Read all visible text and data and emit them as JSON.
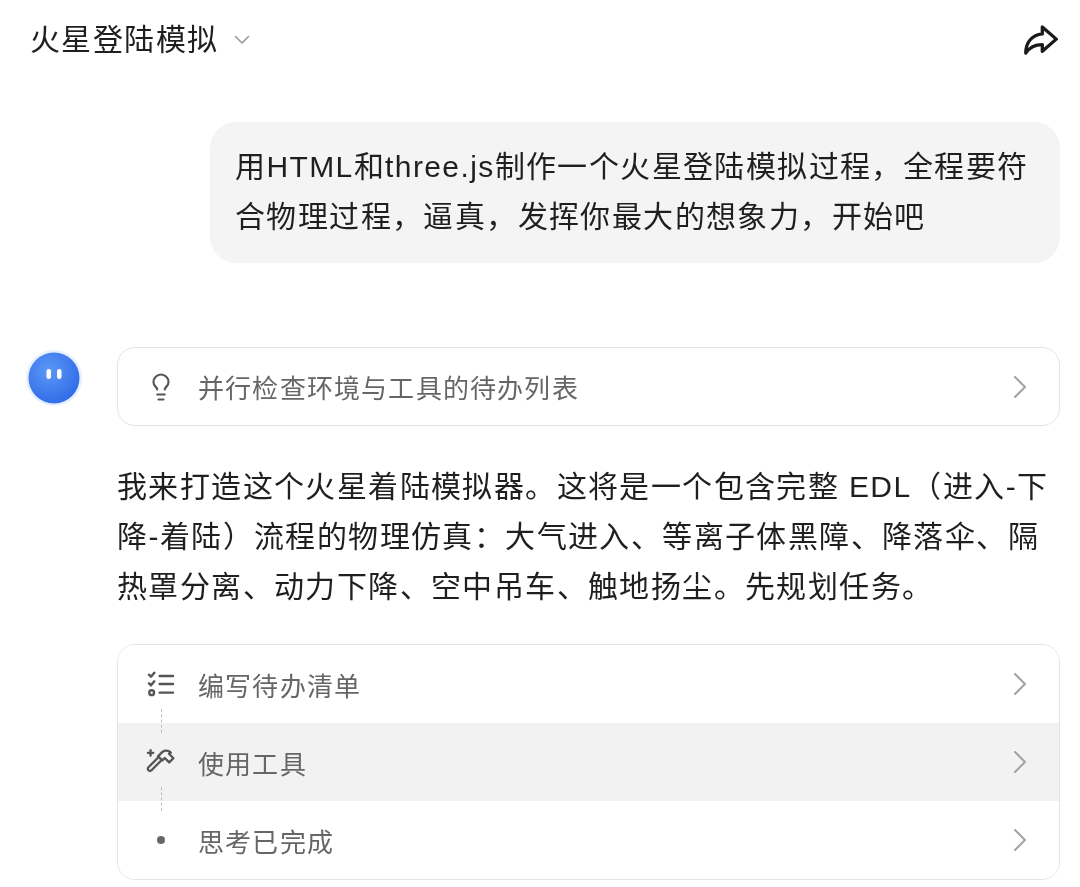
{
  "header": {
    "title": "火星登陆模拟"
  },
  "user_message": {
    "text": "用HTML和three.js制作一个火星登陆模拟过程，全程要符合物理过程，逼真，发挥你最大的想象力，开始吧"
  },
  "assistant": {
    "thought": {
      "label": "并行检查环境与工具的待办列表"
    },
    "reply": "我来打造这个火星着陆模拟器。这将是一个包含完整 EDL（进入-下降-着陆）流程的物理仿真：大气进入、等离子体黑障、降落伞、隔热罩分离、动力下降、空中吊车、触地扬尘。先规划任务。",
    "steps": [
      {
        "kind": "todo",
        "label": "编写待办清单",
        "selected": false
      },
      {
        "kind": "tool",
        "label": "使用工具",
        "selected": true
      },
      {
        "kind": "done",
        "label": "思考已完成",
        "selected": false
      }
    ]
  }
}
